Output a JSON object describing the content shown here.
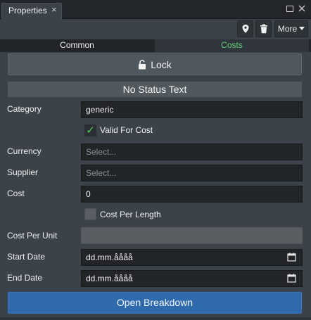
{
  "panel": {
    "tab_title": "Properties",
    "tab_close": "×"
  },
  "toolbar": {
    "more_label": "More"
  },
  "tabs": [
    {
      "label": "Common",
      "active": false
    },
    {
      "label": "Costs",
      "active": true
    }
  ],
  "lock": {
    "label": "Lock"
  },
  "status": {
    "text": "No Status Text"
  },
  "form": {
    "category": {
      "label": "Category",
      "value": "generic"
    },
    "valid_for_cost": {
      "label": "Valid For Cost",
      "checked": true,
      "check_glyph": "✓"
    },
    "currency": {
      "label": "Currency",
      "placeholder": "Select..."
    },
    "supplier": {
      "label": "Supplier",
      "placeholder": "Select..."
    },
    "cost": {
      "label": "Cost",
      "value": "0"
    },
    "cost_per_length": {
      "label": "Cost Per Length",
      "checked": false
    },
    "cost_per_unit": {
      "label": "Cost Per Unit",
      "value": ""
    },
    "start_date": {
      "label": "Start Date",
      "value": "dd.mm.åååå"
    },
    "end_date": {
      "label": "End Date",
      "value": "dd.mm.åååå"
    }
  },
  "open_breakdown": {
    "label": "Open Breakdown"
  },
  "colors": {
    "active_tab_text": "#66d07a",
    "primary_button": "#2f6aad",
    "check_green": "#4ad15b"
  }
}
